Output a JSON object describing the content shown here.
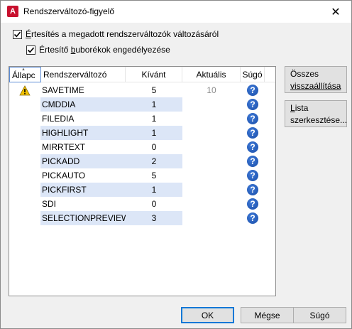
{
  "window": {
    "title": "Rendszerváltozó-figyelő",
    "app_icon_letter": "A",
    "close_glyph": "✕"
  },
  "options": {
    "notify_label_hotkey": "É",
    "notify_label_rest": "rtesítés a megadott rendszerváltozók változásáról",
    "bubbles_label_pre": "Értesítő ",
    "bubbles_label_hotkey": "b",
    "bubbles_label_rest": "uborékok engedélyezése",
    "notify_checked": true,
    "bubbles_checked": true
  },
  "table": {
    "headers": {
      "status": "Állapc",
      "name": "Rendszerváltozó",
      "wanted": "Kívánt",
      "current": "Aktuális",
      "help": "Súgó"
    },
    "rows": [
      {
        "status": "warning-icon",
        "name": "SAVETIME",
        "wanted": "5",
        "current": "10"
      },
      {
        "status": "",
        "name": "CMDDIA",
        "wanted": "1",
        "current": ""
      },
      {
        "status": "",
        "name": "FILEDIA",
        "wanted": "1",
        "current": ""
      },
      {
        "status": "",
        "name": "HIGHLIGHT",
        "wanted": "1",
        "current": ""
      },
      {
        "status": "",
        "name": "MIRRTEXT",
        "wanted": "0",
        "current": ""
      },
      {
        "status": "",
        "name": "PICKADD",
        "wanted": "2",
        "current": ""
      },
      {
        "status": "",
        "name": "PICKAUTO",
        "wanted": "5",
        "current": ""
      },
      {
        "status": "",
        "name": "PICKFIRST",
        "wanted": "1",
        "current": ""
      },
      {
        "status": "",
        "name": "SDI",
        "wanted": "0",
        "current": ""
      },
      {
        "status": "",
        "name": "SELECTIONPREVIEW",
        "wanted": "3",
        "current": ""
      }
    ],
    "help_glyph": "?"
  },
  "side_buttons": {
    "reset_line1": "Összes",
    "reset_line2": "visszaállítása",
    "edit_hotkey": "L",
    "edit_line1_rest": "ista",
    "edit_line2": "szerkesztése..."
  },
  "footer": {
    "ok": "OK",
    "cancel": "Mégse",
    "help": "Súgó"
  },
  "colors": {
    "accent": "#0078d7",
    "row_highlight": "#dce6f7",
    "help_icon": "#1a4ea8",
    "warning": "#f2c200"
  }
}
